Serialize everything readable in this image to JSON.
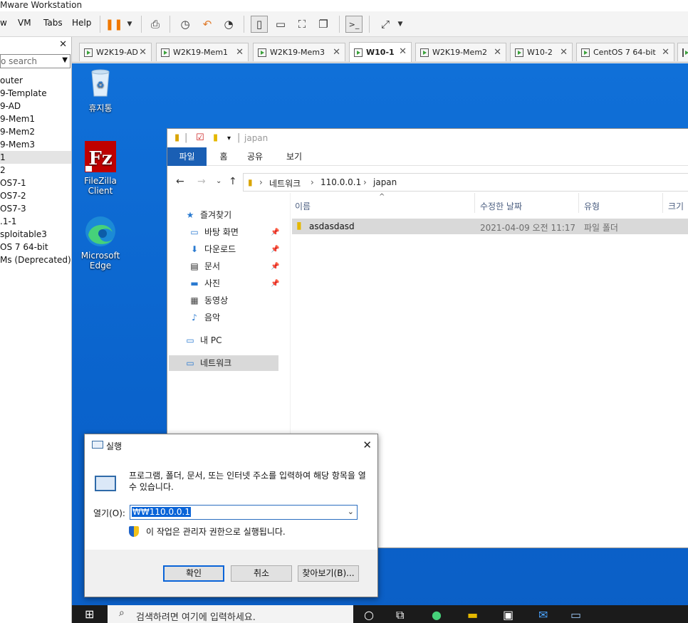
{
  "app_title": "Mware Workstation",
  "menu": [
    "w",
    "VM",
    "Tabs",
    "Help"
  ],
  "library": {
    "search_placeholder": "o search",
    "items": [
      "outer",
      "9-Template",
      "9-AD",
      "9-Mem1",
      "9-Mem2",
      "9-Mem3",
      "1",
      "2",
      "OS7-1",
      "OS7-2",
      "OS7-3",
      ".1-1",
      "sploitable3",
      "OS 7 64-bit",
      "Ms (Deprecated)"
    ]
  },
  "tabs": [
    "W2K19-AD",
    "W2K19-Mem1",
    "W2K19-Mem3",
    "W10-1",
    "W2K19-Mem2",
    "W10-2",
    "CentOS 7 64-bit"
  ],
  "desktop_icons": [
    "휴지통",
    "FileZilla Client",
    "Microsoft Edge"
  ],
  "explorer": {
    "title": "japan",
    "ribbon": [
      "파일",
      "홈",
      "공유",
      "보기"
    ],
    "breadcrumb": [
      "네트워크",
      "110.0.0.1",
      "japan"
    ],
    "nav": {
      "quick_access": "즐겨찾기",
      "desktop": "바탕 화면",
      "downloads": "다운로드",
      "documents": "문서",
      "pictures": "사진",
      "videos": "동영상",
      "music": "음악",
      "this_pc": "내 PC",
      "network": "네트워크"
    },
    "columns": [
      "이름",
      "수정한 날짜",
      "유형",
      "크기"
    ],
    "rows": [
      {
        "name": "asdasdasd",
        "modified": "2021-04-09 오전 11:17",
        "type": "파일 폴더"
      }
    ]
  },
  "run": {
    "title": "실행",
    "description": "프로그램, 폴더, 문서, 또는 인터넷 주소를 입력하여 해당 항목을 열 수 있습니다.",
    "open_label": "열기(O):",
    "input_value": "₩₩110.0.0.1",
    "admin_note": "이 작업은 관리자 권한으로 실행됩니다.",
    "ok": "확인",
    "cancel": "취소",
    "browse": "찾아보기(B)..."
  },
  "taskbar": {
    "search_placeholder": "검색하려면 여기에 입력하세요."
  },
  "colors": {
    "desktop": "#0a63cc",
    "ribbon_file": "#1a5fb4",
    "selection": "#0a64d8"
  }
}
